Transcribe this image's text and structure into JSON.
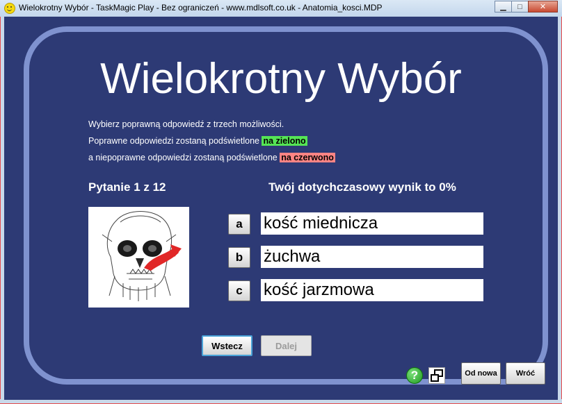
{
  "window": {
    "title": "Wielokrotny Wybór - TaskMagic Play - Bez ograniczeń - www.mdlsoft.co.uk - Anatomia_kosci.MDP",
    "controls": {
      "minimize": "▁",
      "maximize": "□",
      "close": "✕"
    }
  },
  "heading": "Wielokrotny Wybór",
  "instructions": {
    "line1": "Wybierz poprawną odpowiedź z trzech możliwości.",
    "line2_prefix": "Poprawne odpowiedzi zostaną podświetlone ",
    "line2_highlight": "na zielono",
    "line3_prefix": "a niepoprawne odpowiedzi zostaną podświetlone ",
    "line3_highlight": "na czerwono"
  },
  "question": {
    "number_label": "Pytanie 1 z 12",
    "score_label": "Twój dotychczasowy wynik to 0%",
    "options": [
      {
        "key": "a",
        "text": "kość miednicza"
      },
      {
        "key": "b",
        "text": "żuchwa"
      },
      {
        "key": "c",
        "text": "kość jarzmowa"
      }
    ]
  },
  "nav": {
    "back": "Wstecz",
    "next": "Dalej"
  },
  "footer": {
    "reset": "Od nowa",
    "return": "Wróć",
    "help_glyph": "?"
  },
  "colors": {
    "background": "#2d3a75",
    "panel_border": "#7f92cf",
    "correct": "#55e555",
    "wrong": "#ff8484"
  }
}
